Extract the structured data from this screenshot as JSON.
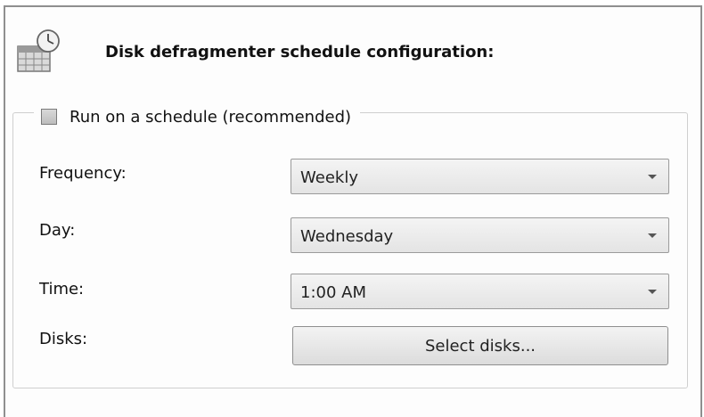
{
  "header": {
    "title": "Disk defragmenter schedule configuration:",
    "icon": "calendar-clock-icon"
  },
  "schedule": {
    "checkbox_label": "Run on a schedule (recommended)",
    "checked": false
  },
  "fields": {
    "frequency": {
      "label": "Frequency:",
      "value": "Weekly"
    },
    "day": {
      "label": "Day:",
      "value": "Wednesday"
    },
    "time": {
      "label": "Time:",
      "value": "1:00 AM"
    },
    "disks": {
      "label": "Disks:",
      "button_label": "Select disks..."
    }
  }
}
